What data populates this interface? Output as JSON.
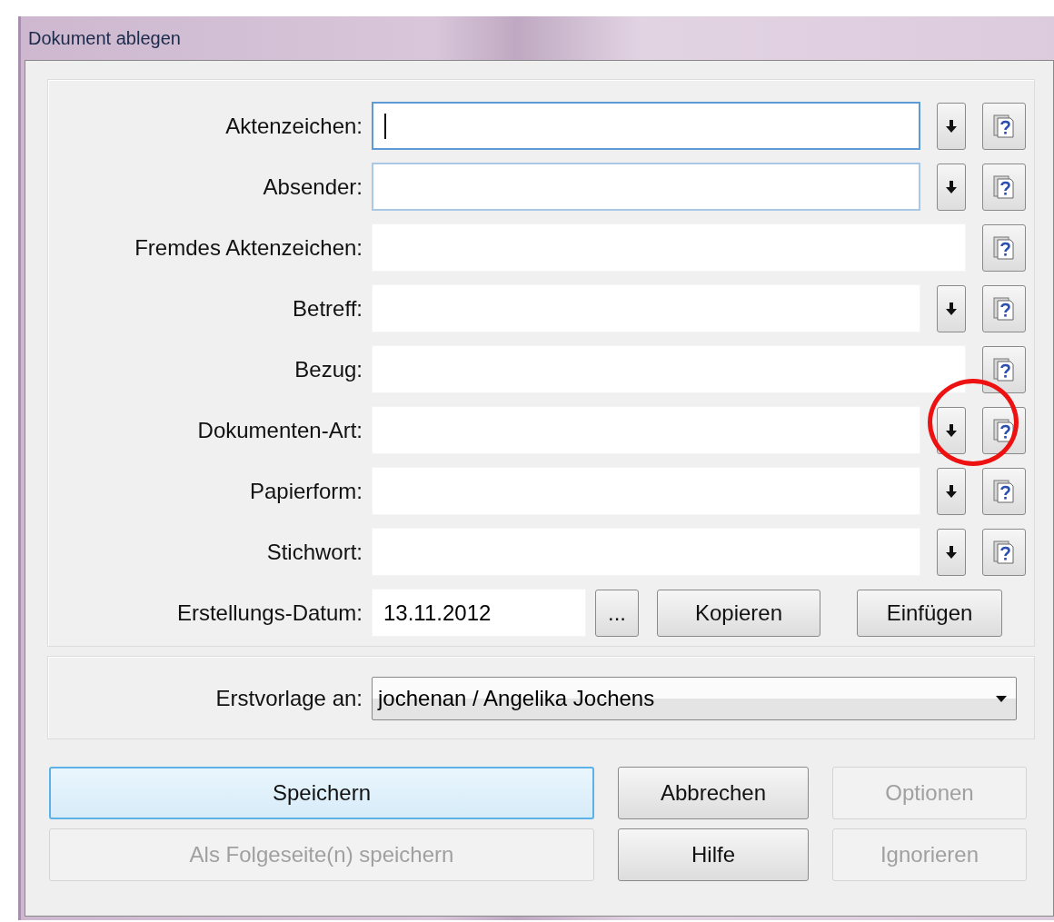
{
  "window": {
    "title": "Dokument ablegen"
  },
  "fields": [
    {
      "label": "Aktenzeichen:",
      "kind": "combo",
      "focused": true,
      "hovered": false,
      "circled": false
    },
    {
      "label": "Absender:",
      "kind": "combo",
      "focused": false,
      "hovered": true,
      "circled": false
    },
    {
      "label": "Fremdes Aktenzeichen:",
      "kind": "text",
      "focused": false,
      "hovered": false,
      "circled": false
    },
    {
      "label": "Betreff:",
      "kind": "combo",
      "focused": false,
      "hovered": false,
      "circled": false
    },
    {
      "label": "Bezug:",
      "kind": "text",
      "focused": false,
      "hovered": false,
      "circled": false
    },
    {
      "label": "Dokumenten-Art:",
      "kind": "combo",
      "focused": false,
      "hovered": false,
      "circled": true
    },
    {
      "label": "Papierform:",
      "kind": "combo",
      "focused": false,
      "hovered": false,
      "circled": false
    },
    {
      "label": "Stichwort:",
      "kind": "combo",
      "focused": false,
      "hovered": false,
      "circled": false
    }
  ],
  "date_row": {
    "label": "Erstellungs-Datum:",
    "value": "13.11.2012",
    "picker": "...",
    "buttons": [
      "Kopieren",
      "Einfügen"
    ]
  },
  "recipient": {
    "label": "Erstvorlage an:",
    "value": "jochenan / Angelika Jochens"
  },
  "buttons": [
    {
      "label": "Speichern",
      "default": true,
      "disabled": false
    },
    {
      "label": "Abbrechen",
      "default": false,
      "disabled": false
    },
    {
      "label": "Optionen",
      "default": false,
      "disabled": true
    },
    {
      "label": "Als Folgeseite(n) speichern",
      "default": false,
      "disabled": true
    },
    {
      "label": "Hilfe",
      "default": false,
      "disabled": false
    },
    {
      "label": "Ignorieren",
      "default": false,
      "disabled": true
    }
  ]
}
